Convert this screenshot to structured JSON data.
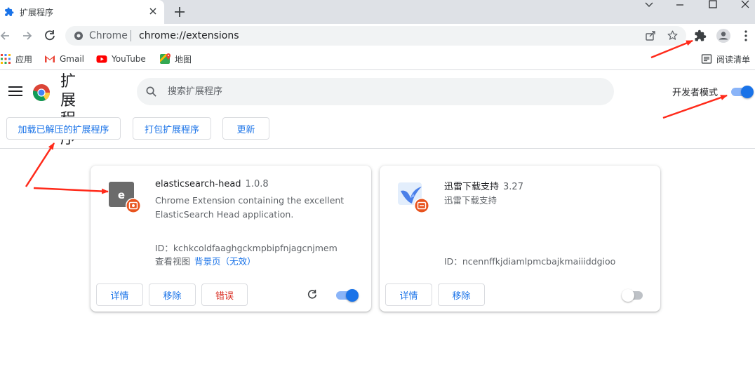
{
  "tab": {
    "title": "扩展程序",
    "favicon": "puzzle-icon"
  },
  "toolbar": {
    "site_label": "Chrome",
    "url": "chrome://extensions"
  },
  "bookmarks": [
    {
      "label": "应用",
      "icon": "apps-grid-icon"
    },
    {
      "label": "Gmail",
      "icon": "gmail-icon"
    },
    {
      "label": "YouTube",
      "icon": "youtube-icon"
    },
    {
      "label": "地图",
      "icon": "maps-icon"
    }
  ],
  "reading_list": "阅读清单",
  "header": {
    "title": "扩展程序",
    "search_placeholder": "搜索扩展程序",
    "dev_mode_label": "开发者模式",
    "dev_mode_on": true
  },
  "actions": {
    "load_unpacked": "加载已解压的扩展程序",
    "pack": "打包扩展程序",
    "update": "更新"
  },
  "extensions": [
    {
      "name": "elasticsearch-head",
      "version": "1.0.8",
      "description": "Chrome Extension containing the excellent ElasticSearch Head application.",
      "id_label": "ID：",
      "id": "kchkcoldfaaghgckmpbipfnjagcnjmem",
      "views_label": "查看视图",
      "views_link": "背景页",
      "views_status": "（无效）",
      "details": "详情",
      "remove": "移除",
      "errors": "错误",
      "enabled": true
    },
    {
      "name": "迅雷下载支持",
      "version": "3.27",
      "description": "迅雷下载支持",
      "id_label": "ID：",
      "id": "ncennffkjdiamlpmcbajkmaiiiddgioo",
      "details": "详情",
      "remove": "移除",
      "enabled": false
    }
  ],
  "colors": {
    "accent": "#1a73e8",
    "error": "#d93025",
    "tabstrip": "#dee1e6",
    "annotation": "#ff2a1a"
  }
}
